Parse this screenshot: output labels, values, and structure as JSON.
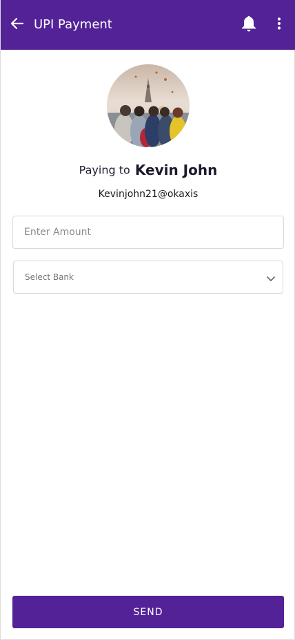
{
  "appbar": {
    "title": "UPI Payment",
    "background_color": "#532297",
    "back_icon": "arrow-left-icon",
    "notification_icon": "bell-icon",
    "menu_icon": "more-vertical-icon"
  },
  "payee": {
    "avatar_icon": "avatar-photo",
    "paying_prefix": "Paying to",
    "name": "Kevin John",
    "upi_id": "Kevinjohn21@okaxis"
  },
  "form": {
    "amount_placeholder": "Enter Amount",
    "amount_value": "",
    "bank_select_label": "Select Bank",
    "bank_select_icon": "chevron-down-icon"
  },
  "actions": {
    "send_label": "SEND",
    "send_color": "#532297"
  }
}
